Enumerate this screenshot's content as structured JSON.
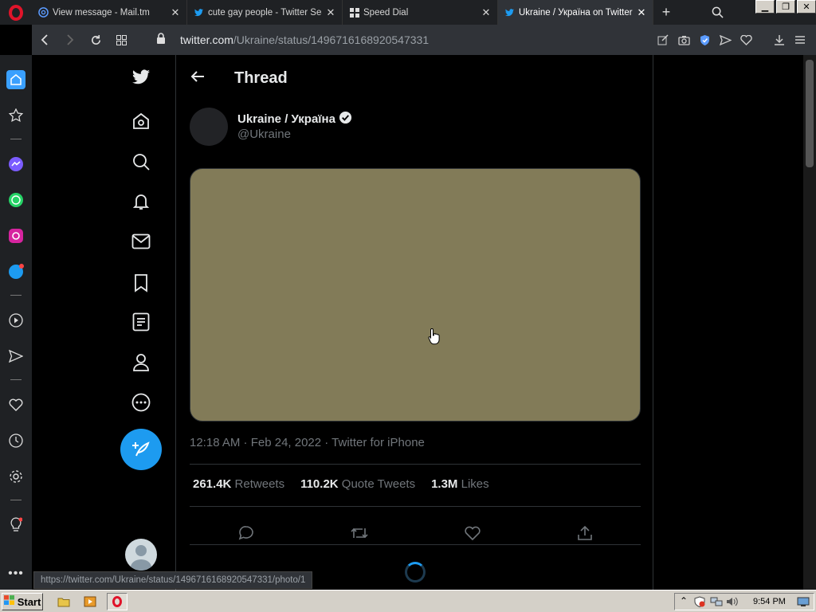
{
  "browser": {
    "tabs": [
      {
        "title": "View message - Mail.tm",
        "icon": "mail-at-icon",
        "active": false
      },
      {
        "title": "cute gay people - Twitter Search",
        "icon": "twitter-bird-icon",
        "active": false
      },
      {
        "title": "Speed Dial",
        "icon": "speed-dial-icon",
        "active": false
      },
      {
        "title": "Ukraine / Україна on Twitter: \"",
        "icon": "twitter-bird-icon",
        "active": true
      }
    ],
    "url_domain": "twitter.com",
    "url_path": "/Ukraine/status/1496716168920547331",
    "status_url": "https://twitter.com/Ukraine/status/1496716168920547331/photo/1"
  },
  "thread": {
    "title": "Thread",
    "display_name": "Ukraine / Україна",
    "handle": "@Ukraine",
    "timestamp": "12:18 AM · Feb 24, 2022 · Twitter for iPhone",
    "stats": [
      {
        "value": "261.4K",
        "label": "Retweets"
      },
      {
        "value": "110.2K",
        "label": "Quote Tweets"
      },
      {
        "value": "1.3M",
        "label": "Likes"
      }
    ],
    "media_color": "#827b58"
  },
  "taskbar": {
    "start_label": "Start",
    "clock": "9:54 PM"
  },
  "colors": {
    "accent": "#1d9bf0",
    "opera_red": "#e0142a"
  }
}
